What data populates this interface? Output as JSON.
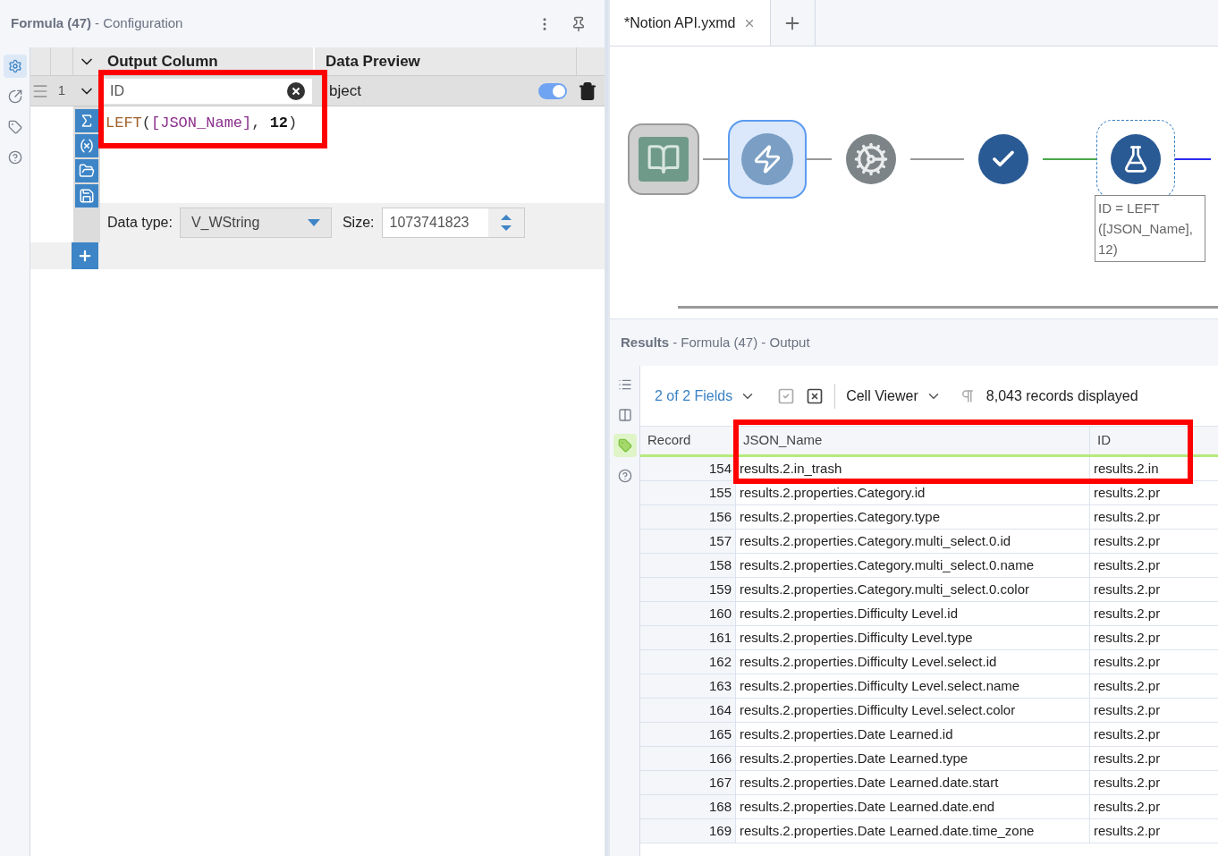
{
  "config": {
    "title": "Formula (47)",
    "subtitle": "- Configuration",
    "sidebar": [
      {
        "kind": "settings",
        "selected": true
      },
      {
        "kind": "connection",
        "selected": false
      },
      {
        "kind": "tag",
        "selected": false
      },
      {
        "kind": "help",
        "selected": false
      }
    ],
    "columns": [
      "Output Column",
      "Data Preview"
    ],
    "formula": {
      "number": "1",
      "output": "ID",
      "preview": "bject",
      "enabled": true,
      "expression": [
        {
          "kind": "function",
          "text": "LEFT"
        },
        {
          "kind": "punct",
          "text": "("
        },
        {
          "kind": "field",
          "text": "[JSON_Name]"
        },
        {
          "kind": "punct",
          "text": ", "
        },
        {
          "kind": "number",
          "text": "12"
        },
        {
          "kind": "punct",
          "text": ")"
        }
      ],
      "data_type_label": "Data type:",
      "data_type": "V_WString",
      "size_label": "Size:",
      "size": "1073741823"
    }
  },
  "workflow": {
    "tabs": [
      {
        "label": "*Notion API.yxmd",
        "selected": true
      }
    ],
    "tools": [
      {
        "kind": "book",
        "selected": false,
        "focused": false
      },
      {
        "kind": "lightning",
        "selected": true,
        "focused": false
      },
      {
        "kind": "gear",
        "selected": false,
        "focused": false
      },
      {
        "kind": "check",
        "selected": false,
        "focused": false
      },
      {
        "kind": "formula",
        "selected": false,
        "focused": true
      }
    ],
    "annotation": "ID = LEFT ([JSON_Name], 12)"
  },
  "results": {
    "title": "Results",
    "subtitle": "- Formula (47) - Output",
    "sidebar": [
      {
        "kind": "list",
        "selected": false
      },
      {
        "kind": "columns",
        "selected": false
      },
      {
        "kind": "tag",
        "selected": true
      },
      {
        "kind": "help",
        "selected": false
      }
    ],
    "fields": "2 of 2 Fields",
    "viewer": "Cell Viewer",
    "count": "8,043 records displayed",
    "columns": [
      "Record",
      "JSON_Name",
      "ID"
    ],
    "rows": [
      [
        "154",
        "results.2.in_trash",
        "results.2.in"
      ],
      [
        "155",
        "results.2.properties.Category.id",
        "results.2.pr"
      ],
      [
        "156",
        "results.2.properties.Category.type",
        "results.2.pr"
      ],
      [
        "157",
        "results.2.properties.Category.multi_select.0.id",
        "results.2.pr"
      ],
      [
        "158",
        "results.2.properties.Category.multi_select.0.name",
        "results.2.pr"
      ],
      [
        "159",
        "results.2.properties.Category.multi_select.0.color",
        "results.2.pr"
      ],
      [
        "160",
        "results.2.properties.Difficulty Level.id",
        "results.2.pr"
      ],
      [
        "161",
        "results.2.properties.Difficulty Level.type",
        "results.2.pr"
      ],
      [
        "162",
        "results.2.properties.Difficulty Level.select.id",
        "results.2.pr"
      ],
      [
        "163",
        "results.2.properties.Difficulty Level.select.name",
        "results.2.pr"
      ],
      [
        "164",
        "results.2.properties.Difficulty Level.select.color",
        "results.2.pr"
      ],
      [
        "165",
        "results.2.properties.Date Learned.id",
        "results.2.pr"
      ],
      [
        "166",
        "results.2.properties.Date Learned.type",
        "results.2.pr"
      ],
      [
        "167",
        "results.2.properties.Date Learned.date.start",
        "results.2.pr"
      ],
      [
        "168",
        "results.2.properties.Date Learned.date.end",
        "results.2.pr"
      ],
      [
        "169",
        "results.2.properties.Date Learned.date.time_zone",
        "results.2.pr"
      ]
    ]
  }
}
